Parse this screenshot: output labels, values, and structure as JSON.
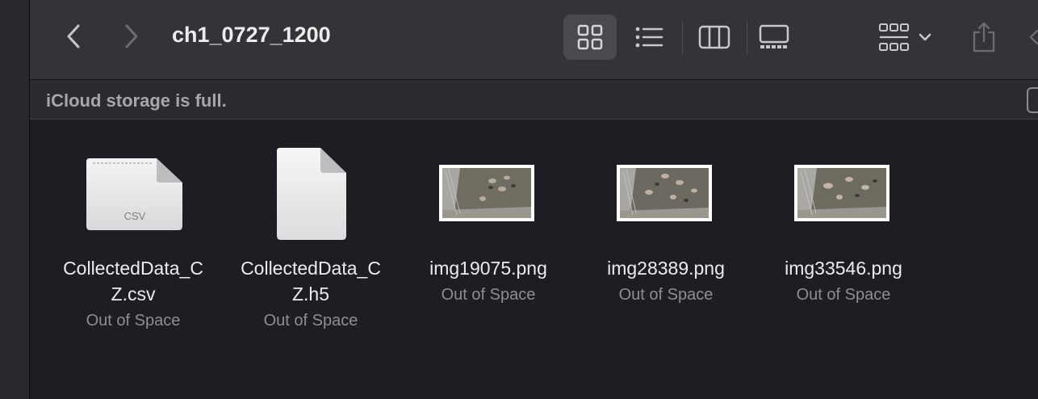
{
  "toolbar": {
    "title": "ch1_0727_1200",
    "back_icon": "chevron-left-icon",
    "forward_icon": "chevron-right-icon",
    "view_modes": [
      "icon-view",
      "list-view",
      "column-view",
      "gallery-view"
    ],
    "active_view": "icon-view",
    "group_icon": "group-grid-icon",
    "share_icon": "share-icon"
  },
  "banner": {
    "text": "iCloud storage is full."
  },
  "files": [
    {
      "name": "CollectedData_CZ.csv",
      "name_line1": "CollectedData_C",
      "name_line2": "Z.csv",
      "status": "Out of Space",
      "kind": "csv",
      "badge": "CSV"
    },
    {
      "name": "CollectedData_CZ.h5",
      "name_line1": "CollectedData_C",
      "name_line2": "Z.h5",
      "status": "Out of Space",
      "kind": "document"
    },
    {
      "name": "img19075.png",
      "name_line1": "img19075.png",
      "status": "Out of Space",
      "kind": "image"
    },
    {
      "name": "img28389.png",
      "name_line1": "img28389.png",
      "status": "Out of Space",
      "kind": "image"
    },
    {
      "name": "img33546.png",
      "name_line1": "img33546.png",
      "status": "Out of Space",
      "kind": "image"
    }
  ],
  "colors": {
    "window_bg": "#1f1c24",
    "toolbar_bg": "#353337",
    "text_primary": "#ececed",
    "text_secondary": "#8f8d93"
  }
}
